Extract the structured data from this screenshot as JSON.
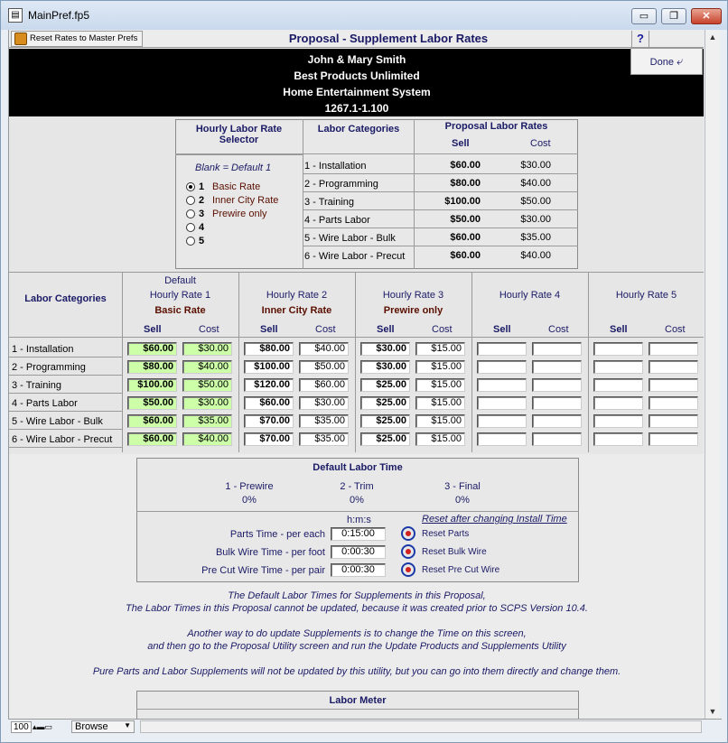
{
  "window": {
    "title": "MainPref.fp5",
    "minimize": "▭",
    "restore": "❐",
    "close": "✕"
  },
  "header": {
    "reset_label": "Reset Rates to Master Prefs",
    "title": "Proposal - Supplement Labor Rates",
    "help": "?",
    "done_label": "Done"
  },
  "customer": {
    "name": "John & Mary Smith",
    "company": "Best Products Unlimited",
    "system": "Home Entertainment System",
    "number": "1267.1-1.100"
  },
  "selector": {
    "col1_title": "Hourly Labor Rate Selector",
    "col2_title": "Labor Categories",
    "col3_title": "Proposal Labor Rates",
    "sell": "Sell",
    "cost": "Cost",
    "blank_note": "Blank = Default 1",
    "options": [
      {
        "num": "1",
        "label": "Basic Rate",
        "selected": true
      },
      {
        "num": "2",
        "label": "Inner City Rate",
        "selected": false
      },
      {
        "num": "3",
        "label": "Prewire only",
        "selected": false
      },
      {
        "num": "4",
        "label": "",
        "selected": false
      },
      {
        "num": "5",
        "label": "",
        "selected": false
      }
    ],
    "rows": [
      {
        "cat": "1 - Installation",
        "sell": "$60.00",
        "cost": "$30.00"
      },
      {
        "cat": "2 - Programming",
        "sell": "$80.00",
        "cost": "$40.00"
      },
      {
        "cat": "3 - Training",
        "sell": "$100.00",
        "cost": "$50.00"
      },
      {
        "cat": "4 - Parts Labor",
        "sell": "$50.00",
        "cost": "$30.00"
      },
      {
        "cat": "5 - Wire Labor - Bulk",
        "sell": "$60.00",
        "cost": "$35.00"
      },
      {
        "cat": "6 - Wire Labor - Precut",
        "sell": "$60.00",
        "cost": "$40.00"
      }
    ]
  },
  "rates": {
    "cat_header": "Labor Categories",
    "sell": "Sell",
    "cost": "Cost",
    "columns": [
      {
        "top": "Default",
        "title": "Hourly Rate 1",
        "sub": "Basic Rate"
      },
      {
        "top": "",
        "title": "Hourly Rate 2",
        "sub": "Inner City Rate"
      },
      {
        "top": "",
        "title": "Hourly Rate 3",
        "sub": "Prewire only"
      },
      {
        "top": "",
        "title": "Hourly Rate 4",
        "sub": ""
      },
      {
        "top": "",
        "title": "Hourly Rate 5",
        "sub": ""
      }
    ],
    "categories": [
      "1 - Installation",
      "2 - Programming",
      "3 - Training",
      "4 - Parts Labor",
      "5 - Wire Labor - Bulk",
      "6 - Wire Labor - Precut"
    ],
    "values": [
      [
        [
          "$60.00",
          "$30.00"
        ],
        [
          "$80.00",
          "$40.00"
        ],
        [
          "$30.00",
          "$15.00"
        ],
        [
          "",
          ""
        ],
        [
          "",
          ""
        ]
      ],
      [
        [
          "$80.00",
          "$40.00"
        ],
        [
          "$100.00",
          "$50.00"
        ],
        [
          "$30.00",
          "$15.00"
        ],
        [
          "",
          ""
        ],
        [
          "",
          ""
        ]
      ],
      [
        [
          "$100.00",
          "$50.00"
        ],
        [
          "$120.00",
          "$60.00"
        ],
        [
          "$25.00",
          "$15.00"
        ],
        [
          "",
          ""
        ],
        [
          "",
          ""
        ]
      ],
      [
        [
          "$50.00",
          "$30.00"
        ],
        [
          "$60.00",
          "$30.00"
        ],
        [
          "$25.00",
          "$15.00"
        ],
        [
          "",
          ""
        ],
        [
          "",
          ""
        ]
      ],
      [
        [
          "$60.00",
          "$35.00"
        ],
        [
          "$70.00",
          "$35.00"
        ],
        [
          "$25.00",
          "$15.00"
        ],
        [
          "",
          ""
        ],
        [
          "",
          ""
        ]
      ],
      [
        [
          "$60.00",
          "$40.00"
        ],
        [
          "$70.00",
          "$35.00"
        ],
        [
          "$25.00",
          "$15.00"
        ],
        [
          "",
          ""
        ],
        [
          "",
          ""
        ]
      ]
    ]
  },
  "labor_time": {
    "title": "Default Labor Time",
    "phases": [
      {
        "label": "1 - Prewire",
        "pct": "0%"
      },
      {
        "label": "2 - Trim",
        "pct": "0%"
      },
      {
        "label": "3 - Final",
        "pct": "0%"
      }
    ],
    "hms": "h:m:s",
    "reset_note": "Reset after changing Install Time",
    "rows": [
      {
        "label": "Parts Time - per each",
        "value": "0:15:00",
        "reset": "Reset Parts"
      },
      {
        "label": "Bulk Wire Time - per foot",
        "value": "0:00:30",
        "reset": "Reset Bulk Wire"
      },
      {
        "label": "Pre Cut Wire Time - per pair",
        "value": "0:00:30",
        "reset": "Reset Pre Cut Wire"
      }
    ]
  },
  "notes": {
    "line1": "The Default Labor Times for Supplements in this Proposal,",
    "line2": "The Labor Times in this Proposal cannot be updated, because it was created prior to SCPS Version 10.4.",
    "line3": "Another way to do update Supplements is to change the Time on this screen,",
    "line4": "and then go to the Proposal Utility screen and run the Update Products and Supplements Utility",
    "line5": "Pure Parts and Labor Supplements will not be updated by this utility, but you can go into them directly and change them."
  },
  "meter": {
    "title": "Labor Meter"
  },
  "status": {
    "zoom": "100",
    "mode": "Browse"
  }
}
